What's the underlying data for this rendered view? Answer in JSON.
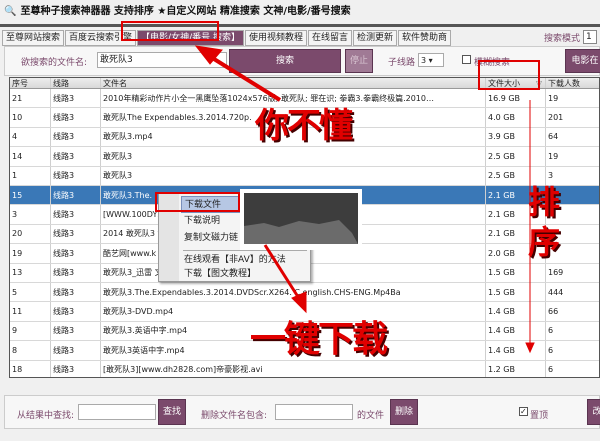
{
  "window": {
    "title": "至尊种子搜索神器器 支持排序 ★自定义网站 精准搜索  文神/电影/番号搜索"
  },
  "tabs": [
    {
      "label": "至尊网站搜索"
    },
    {
      "label": "百度云搜索引擎"
    },
    {
      "label": "【电影/女神/番号  搜索】",
      "active": true
    },
    {
      "label": "使用视频教程"
    },
    {
      "label": "在线留言"
    },
    {
      "label": "检测更新"
    },
    {
      "label": "软件赞助商"
    }
  ],
  "search_mode": {
    "label": "搜索模式",
    "value": "1"
  },
  "search": {
    "label": "欲搜索的文件名:",
    "value": "敢死队3",
    "search_button": "搜索",
    "stop_button": "停止",
    "subline_label": "子线路",
    "subline_value": "3",
    "fuzzy_label": "模糊搜索",
    "fuzzy_checked": false,
    "movie_button": "电影在"
  },
  "table": {
    "headers": [
      "序号",
      "线路",
      "文件名",
      "文件大小",
      "下载人数"
    ],
    "sort_indicator": "▽",
    "selected_index": 5,
    "rows": [
      [
        "21",
        "线路3",
        "2010年精彩动作片小全一黑鹰坠落1024x576版; 敢死队; 罪在识; 拳霸3.拳霸终极篇.2010…",
        "16.9 GB",
        "19"
      ],
      [
        "10",
        "线路3",
        "敢死队The Expendables.3.2014.720p.",
        "4.0 GB",
        "201"
      ],
      [
        "4",
        "线路3",
        "敢死队3.mp4",
        "3.9 GB",
        "64"
      ],
      [
        "14",
        "线路3",
        "敢死队3",
        "2.5 GB",
        "19"
      ],
      [
        "1",
        "线路3",
        "敢死队3",
        "2.5 GB",
        "3"
      ],
      [
        "15",
        "线路3",
        "敢死队3.The.",
        "2.1 GB",
        ""
      ],
      [
        "3",
        "线路3",
        "[WWW.100DYS.                                          Scr [G2G]-muxed.mkv",
        "2.1 GB",
        ""
      ],
      [
        "20",
        "线路3",
        "2014 敢死队3                                           viD-XWCTY.2.0SGB",
        "2.1 GB",
        ""
      ],
      [
        "19",
        "线路3",
        "酷艺网[www.k                                           014.HD480p.x264.AAC 英语中字",
        "2.0 GB",
        ""
      ],
      [
        "13",
        "线路3",
        "敢死队3_迅雷                                           文字幕.torrent.wmv",
        "1.5 GB",
        "169"
      ],
      [
        "5",
        "线路3",
        "敢死队3.The.Expendables.3.2014.DVDScr.X264.    C.english.CHS-ENG.Mp4Ba",
        "1.5 GB",
        "444"
      ],
      [
        "11",
        "线路3",
        "敢死队3-DVD.mp4",
        "1.4 GB",
        "66"
      ],
      [
        "9",
        "线路3",
        "敢死队3.英语中字.mp4",
        "1.4 GB",
        "6"
      ],
      [
        "8",
        "线路3",
        "敢死队3英语中字.mp4",
        "1.4 GB",
        "6"
      ],
      [
        "18",
        "线路3",
        "[敢死队3][www.dh2828.com]帝豪影视.avi",
        "1.2 GB",
        "6"
      ]
    ]
  },
  "context_menu": {
    "items": [
      "下载文件",
      "下载说明",
      "复制文磁力链",
      "在线观看【非AV】的方法",
      "下载【图文教程】"
    ]
  },
  "bottom": {
    "find_label": "从结果中查找:",
    "find_value": "",
    "find_button": "查找",
    "delete_label": "删除文件名包含:",
    "delete_value": "",
    "delete_suffix": "的文件",
    "delete_button": "删除",
    "pin_label": "置顶",
    "pin_checked": true,
    "right_button": "改"
  },
  "annotations": {
    "text1": "你不懂",
    "text2": "排序",
    "text3": "一键下载"
  },
  "colors": {
    "accent": "#7b4a6c",
    "selection": "#3a78b7",
    "annotation": "#e00000"
  }
}
